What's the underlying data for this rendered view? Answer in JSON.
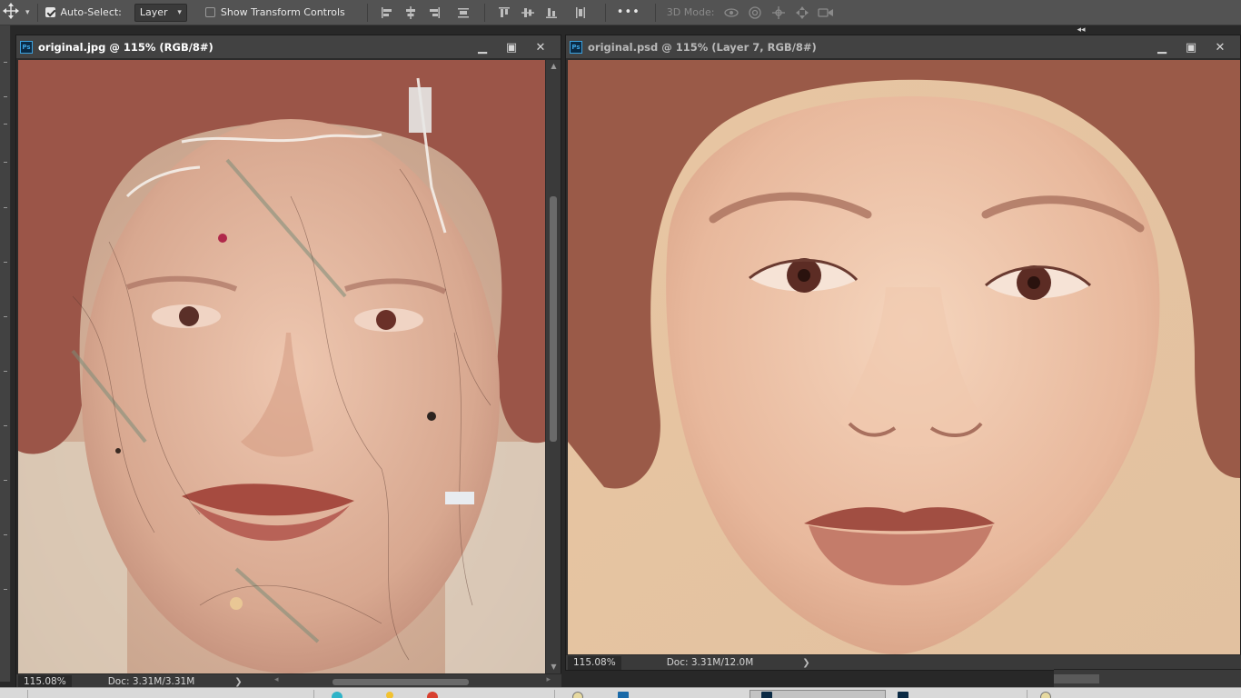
{
  "options_bar": {
    "tool_icon": "move-tool-icon",
    "auto_select_label": "Auto-Select:",
    "auto_select_checked": true,
    "layer_dropdown_value": "Layer",
    "show_transform_label": "Show Transform Controls",
    "show_transform_checked": false,
    "more_label": "•••",
    "mode_3d_label": "3D Mode:"
  },
  "documents": [
    {
      "title": "original.jpg @ 115% (RGB/8#)",
      "zoom": "115.08%",
      "doc_info": "Doc: 3.31M/3.31M",
      "stat_arrow": "❯",
      "image": "damaged-portrait-photo"
    },
    {
      "title": "original.psd @ 115% (Layer 7, RGB/8#)",
      "zoom": "115.08%",
      "doc_info": "Doc: 3.31M/12.0M",
      "stat_arrow": "❯",
      "image": "restored-portrait-photo"
    }
  ],
  "colors": {
    "app_bg": "#282828",
    "options_bar_bg": "#535353",
    "title_bar_bg": "#424242",
    "ps_icon_blue": "#3ba2e0"
  }
}
